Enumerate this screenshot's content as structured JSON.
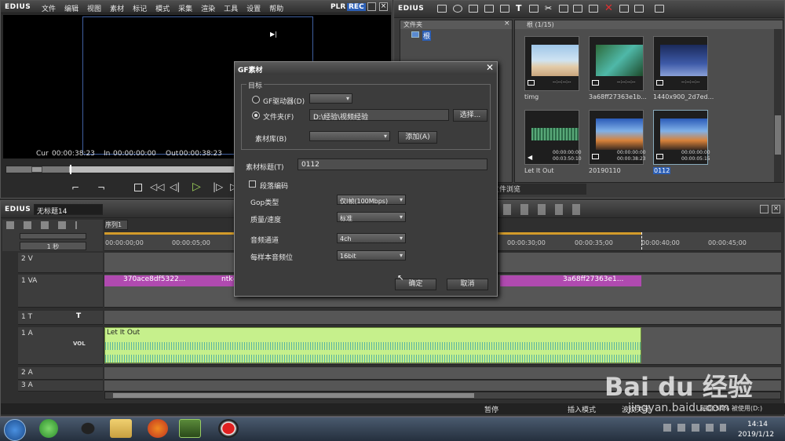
{
  "player": {
    "brand": "EDIUS",
    "menu": [
      "文件",
      "编辑",
      "视图",
      "素材",
      "标记",
      "模式",
      "采集",
      "渲染",
      "工具",
      "设置",
      "帮助"
    ],
    "mode_plr": "PLR",
    "mode_rec": "REC",
    "cur_label": "Cur",
    "cur_value": "00:00:38:23",
    "in_label": "In",
    "in_value": "00:00:00:00",
    "out_label": "Out",
    "out_value": "00:00:38:23"
  },
  "bin": {
    "brand": "EDIUS",
    "folder_header": "文件夹",
    "root_folder": "根",
    "path": "根 (1/15)",
    "tab_label": "文件浏览",
    "thumbnails": [
      {
        "name": "timg",
        "tc1": "--:--:--:--",
        "tc2": "--:--:--:--"
      },
      {
        "name": "3a68ff27363e1b...",
        "tc1": "--:--:--:--",
        "tc2": "--:--:--:--"
      },
      {
        "name": "1440x900_2d7ed...",
        "tc1": "--:--:--:--",
        "tc2": "--:--:--:--"
      },
      {
        "name": "Let It Out",
        "tc1": "00:00:00:00",
        "tc2": "00:03:50:10"
      },
      {
        "name": "20190110",
        "tc1": "00:00:00:00",
        "tc2": "00:00:38:23"
      },
      {
        "name": "0112",
        "tc1": "00:00:00:00",
        "tc2": "00:00:05:15"
      }
    ]
  },
  "timeline": {
    "brand": "EDIUS",
    "project_name": "无标题14",
    "sequence_tab": "序列1",
    "zoom_label": "1 秒",
    "ruler": [
      "00:00:00;00",
      "00:00:05;00",
      "00:00:30;00",
      "00:00:35;00",
      "00:00:40;00",
      "00:00:45;00"
    ],
    "tracks": [
      {
        "name": "2 V"
      },
      {
        "name": "1 VA"
      },
      {
        "name": "1 T"
      },
      {
        "name": "1 A"
      },
      {
        "name": "2 A"
      },
      {
        "name": "3 A"
      }
    ],
    "vol_label": "VOL",
    "clip_v1a": "370ace8df5322...",
    "clip_v1b": "ntk-",
    "clip_v1c": "3a68ff27363e1...",
    "clip_audio": "Let It Out"
  },
  "dialog": {
    "title": "GF素材",
    "group_target": "目标",
    "radio_gf": "GF驱动器(D)",
    "radio_folder": "文件夹(F)",
    "folder_path": "D:\\经验\\视频经验",
    "browse_button": "选择...",
    "bin_label": "素材库(B)",
    "add_button": "添加(A)",
    "clip_title_label": "素材标题(T)",
    "clip_title_value": "0112",
    "checkbox_label": "段落编码",
    "gop_label": "Gop类型",
    "gop_value": "仅I帧(100Mbps)",
    "quality_label": "质量/速度",
    "quality_value": "标准",
    "audio_ch_label": "音频通道",
    "audio_ch_value": "4ch",
    "bits_label": "每样本音频位",
    "bits_value": "16bit",
    "ok_button": "确定",
    "cancel_button": "取消"
  },
  "status": {
    "pause": "暂停",
    "insert": "插入模式",
    "ripple": "波纹关闭",
    "disk": "磁盘:54% 被使用(D:)"
  },
  "taskbar": {
    "time": "14:14",
    "date": "2019/1/12"
  },
  "watermark": {
    "text": "Bai du 经验",
    "url": "jingyan.baidu.com"
  }
}
